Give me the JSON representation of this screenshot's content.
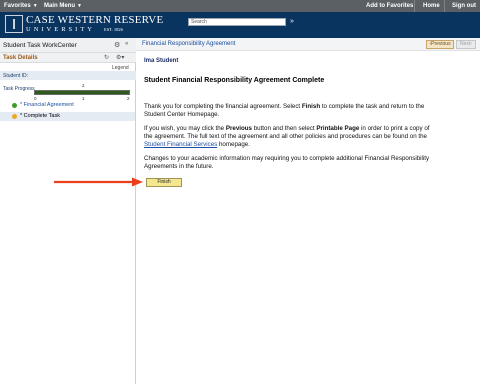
{
  "topnav": {
    "favorites": "Favorites",
    "main_menu": "Main Menu",
    "add_to_favorites": "Add to Favorites",
    "home": "Home",
    "sign_out": "Sign out"
  },
  "brand": {
    "line1": "CASE WESTERN RESERVE",
    "line2": "UNIVERSITY",
    "est": "EST. 1826"
  },
  "search": {
    "placeholder": "Search"
  },
  "left_panel": {
    "title": "Student Task WorkCenter",
    "task_details": "Task Details",
    "legend": "Legend",
    "student_id_label": "Student ID:",
    "task_progress_label": "Task Progress",
    "progress": {
      "min": "0",
      "current": "2",
      "mid": "1",
      "max": "2",
      "fraction": 1.0
    },
    "tasks": [
      {
        "label": "* Financial Agreement",
        "status": "complete"
      },
      {
        "label": "* Complete Task",
        "status": "current"
      }
    ]
  },
  "content": {
    "breadcrumb": "Financial Responsibility Agreement",
    "previous_label": "Previous",
    "next_label": "Next",
    "student_label": "Ima Student",
    "heading": "Student Financial Responsibility Agreement Complete",
    "p1_a": "Thank you for completing the financial agreement. Select ",
    "p1_b": "Finish",
    "p1_c": " to complete the task and return to the Student Center Homepage.",
    "p2_a": "If you wish, you may click the ",
    "p2_b": "Previous",
    "p2_c": " button and then select ",
    "p2_d": "Printable Page",
    "p2_e": " in order to print a copy of the agreement. The full text of the agreement and all other policies and procedures can be found on the ",
    "p2_link": "Student Financial Services",
    "p2_f": " homepage.",
    "p3": "Changes to your academic information may requiring you to complete additional Financial Responsibility Agreements in the future.",
    "finish_label": "Finish"
  },
  "colors": {
    "nav": "#5a6064",
    "banner": "#0a3460",
    "link": "#1d4fa0",
    "arrow": "#e8401c",
    "finish_button": "#f5e690"
  }
}
